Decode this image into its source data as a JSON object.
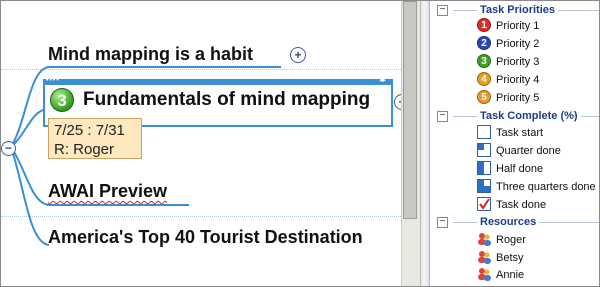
{
  "map": {
    "topics": [
      {
        "id": "habit",
        "label": "Mind mapping is a habit"
      },
      {
        "id": "fund",
        "label": "Fundamentals of mind mapping",
        "priority": "3"
      },
      {
        "id": "awai",
        "label": "AWAI Preview"
      },
      {
        "id": "america",
        "label": "America's Top 40 Tourist Destination"
      }
    ],
    "task_info": {
      "dates": "7/25 : 7/31",
      "resource": "R: Roger"
    },
    "plus_symbol": "+",
    "minus_symbol": "−"
  },
  "panel": {
    "task_priorities": {
      "title": "Task Priorities",
      "items": [
        {
          "label": "Priority 1",
          "number": "1",
          "color": "#d8302a"
        },
        {
          "label": "Priority 2",
          "number": "2",
          "color": "#2a48b8"
        },
        {
          "label": "Priority 3",
          "number": "3",
          "color": "#3aa324"
        },
        {
          "label": "Priority 4",
          "number": "4",
          "color": "#e2a21c"
        },
        {
          "label": "Priority 5",
          "number": "5",
          "color": "#e89a2c"
        }
      ]
    },
    "task_complete": {
      "title": "Task Complete (%)",
      "items": [
        {
          "label": "Task start",
          "fraction": 0
        },
        {
          "label": "Quarter done",
          "fraction": 0.25
        },
        {
          "label": "Half done",
          "fraction": 0.5
        },
        {
          "label": "Three quarters done",
          "fraction": 0.75
        },
        {
          "label": "Task done",
          "fraction": 1
        }
      ]
    },
    "resources": {
      "title": "Resources",
      "items": [
        {
          "label": "Roger"
        },
        {
          "label": "Betsy"
        },
        {
          "label": "Annie"
        }
      ]
    },
    "collapse_symbol": "−"
  },
  "colors": {
    "selection": "#3a8fd6",
    "branch": "#3a8fd6",
    "header_text": "#1c3c8c"
  }
}
